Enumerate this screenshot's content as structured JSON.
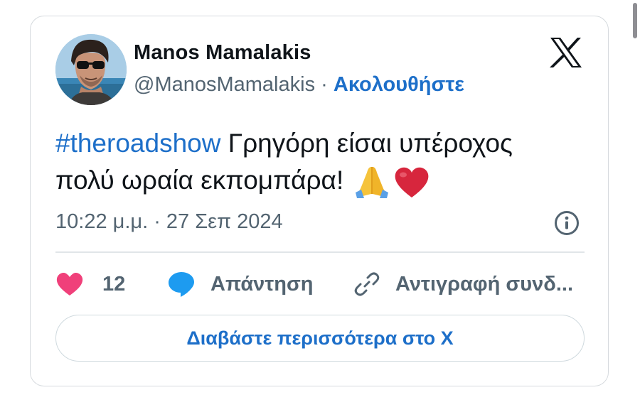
{
  "author": {
    "name": "Manos Mamalakis",
    "handle": "@ManosMamalakis",
    "separator": "·",
    "follow_label": "Ακολουθήστε"
  },
  "tweet": {
    "hashtag": "#theroadshow",
    "text_part1": " Γρηγόρη είσαι υπέροχος",
    "text_part2": "πολύ ωραία εκπομπάρα! ",
    "emojis": [
      "folded-hands",
      "red-heart"
    ]
  },
  "timestamp": "10:22 μ.μ. · 27 Σεπ 2024",
  "actions": {
    "like_count": "12",
    "reply_label": "Απάντηση",
    "copy_link_label": "Αντιγραφή συνδ..."
  },
  "read_more_label": "Διαβάστε περισσότερα στο X",
  "colors": {
    "accent": "#1d6fc9",
    "like": "#f0407a",
    "reply": "#1d9bf0",
    "muted": "#536471"
  },
  "icons": {
    "brand": "x-logo-icon",
    "info": "info-icon",
    "like": "heart-icon",
    "reply": "speech-bubble-icon",
    "copy": "link-icon"
  }
}
